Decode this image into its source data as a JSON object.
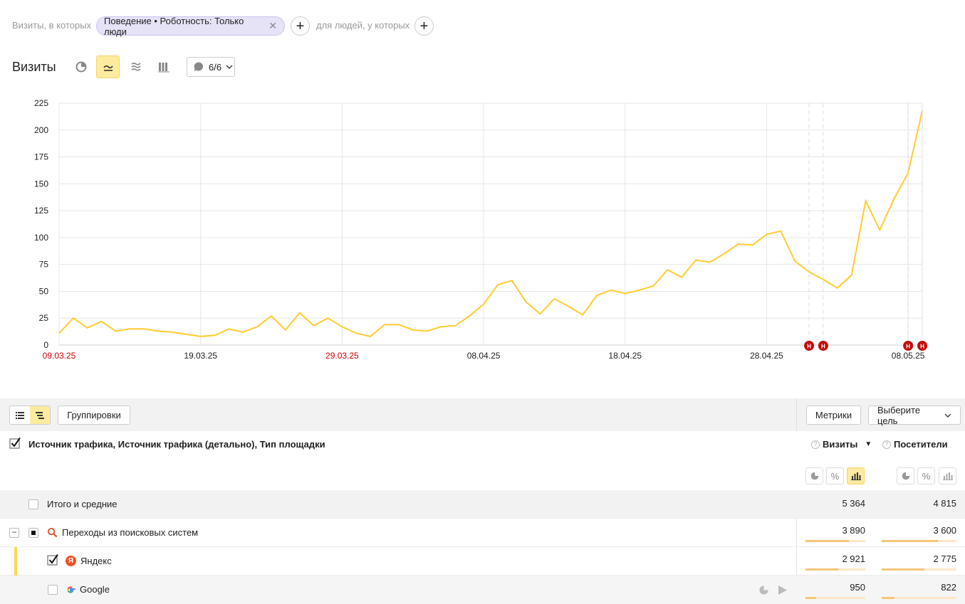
{
  "segment": {
    "prefix": "Визиты, в которых",
    "chip_label": "Поведение • Роботность: Только люди",
    "people_label": "для людей, у которых"
  },
  "report": {
    "title": "Визиты",
    "notes_label": "6/6"
  },
  "chart_data": {
    "type": "line",
    "color": "#ffcc2e",
    "ylim": [
      0,
      225
    ],
    "yticks": [
      "0",
      "25",
      "50",
      "75",
      "100",
      "125",
      "150",
      "175",
      "200",
      "225"
    ],
    "xtick_labels": [
      {
        "label": "09.03.25",
        "holiday": true
      },
      {
        "label": "19.03.25",
        "holiday": false
      },
      {
        "label": "29.03.25",
        "holiday": true
      },
      {
        "label": "08.04.25",
        "holiday": false
      },
      {
        "label": "18.04.25",
        "holiday": false
      },
      {
        "label": "28.04.25",
        "holiday": false
      },
      {
        "label": "08.05.25",
        "holiday": false
      }
    ],
    "x_start": "09.03.25",
    "x_end": "09.05.25",
    "values": [
      11,
      25,
      16,
      22,
      13,
      15,
      15,
      13,
      12,
      10,
      8,
      9,
      15,
      12,
      17,
      27,
      14,
      30,
      18,
      25,
      17,
      11,
      8,
      19,
      19,
      14,
      13,
      17,
      18,
      27,
      38,
      56,
      60,
      40,
      29,
      43,
      36,
      28,
      46,
      51,
      48,
      51,
      55,
      70,
      63,
      79,
      77,
      85,
      94,
      93,
      103,
      106,
      78,
      68,
      61,
      53,
      65,
      134,
      107,
      136,
      160,
      218
    ],
    "markers": [
      {
        "date": "01.05.25",
        "label": "Н"
      },
      {
        "date": "02.05.25",
        "label": "Н"
      },
      {
        "date": "08.05.25",
        "label": "Н"
      },
      {
        "date": "09.05.25",
        "label": "Н"
      }
    ]
  },
  "table": {
    "groupings_label": "Группировки",
    "metrics_label": "Метрики",
    "goal_label": "Выберите цель",
    "dimensions_title": "Источник трафика, Источник трафика (детально), Тип площадки",
    "columns": [
      "Визиты",
      "Посетители"
    ],
    "sort_indicator": "▼",
    "total": {
      "label": "Итого и средние",
      "visits": "5 364",
      "visitors": "4 815"
    },
    "rows": [
      {
        "label": "Переходы из поисковых систем",
        "visits": "3 890",
        "visitors": "3 600",
        "visits_share": 0.725,
        "visitors_share": 0.748
      },
      {
        "label": "Яндекс",
        "visits": "2 921",
        "visitors": "2 775",
        "visits_share": 0.545,
        "visitors_share": 0.576
      },
      {
        "label": "Google",
        "visits": "950",
        "visitors": "822",
        "visits_share": 0.177,
        "visitors_share": 0.171
      }
    ]
  }
}
